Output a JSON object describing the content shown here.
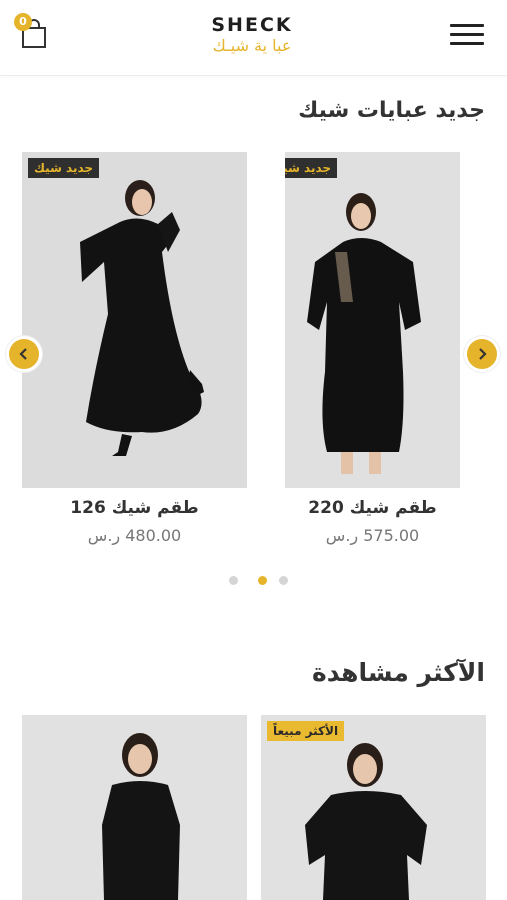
{
  "header": {
    "cart_count": "0",
    "logo_en": "SHECK",
    "logo_ar": "عبا ية شيـك"
  },
  "sections": {
    "new_title": "جديد عبايات شيك",
    "most_viewed_title": "الآكثر مشاهدة"
  },
  "new_products": [
    {
      "badge": "جديد شيك",
      "name": "طقم شيك 126",
      "price": "480.00 ر.س"
    },
    {
      "badge": "جديد شيك",
      "name": "طقم شيك 220",
      "price": "575.00 ر.س"
    }
  ],
  "most_viewed_products": [
    {
      "badge": ""
    },
    {
      "badge": "الأكثر مبيعاً"
    }
  ],
  "slider": {
    "active_dot": 2,
    "dot_count": 3
  },
  "colors": {
    "accent": "#e5b42b",
    "badge_dark": "#2f2f2f",
    "image_bg": "#dadada"
  },
  "icons": [
    "cart-icon",
    "menu-icon",
    "chevron-left-icon",
    "chevron-right-icon"
  ]
}
